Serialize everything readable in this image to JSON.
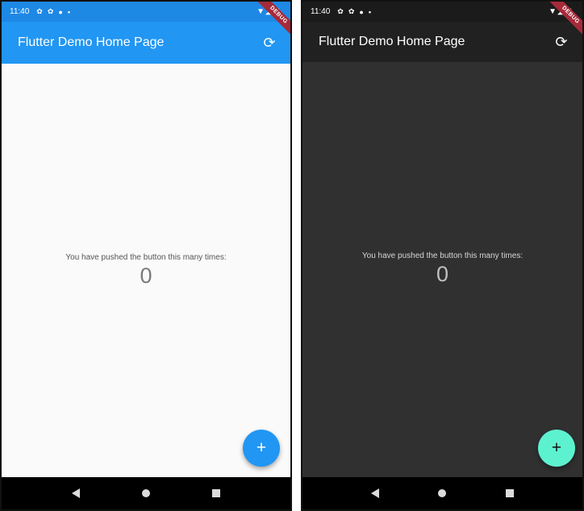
{
  "screens": [
    {
      "theme": "light",
      "status": {
        "time": "11:40",
        "right": "▼◢ ▮"
      },
      "ribbon": "DEBUG",
      "appbar": {
        "title": "Flutter Demo Home Page",
        "action_icon": "refresh-icon",
        "action_glyph": "⟳"
      },
      "counter": {
        "label": "You have pushed the button this many times:",
        "value": "0"
      },
      "fab": {
        "icon": "add-icon",
        "glyph": "+"
      },
      "colors": {
        "primary": "#2196f3",
        "background": "#fafafa",
        "fab": "#2196f3"
      }
    },
    {
      "theme": "dark",
      "status": {
        "time": "11:40",
        "right": "▼◢ ▮"
      },
      "ribbon": "DEBUG",
      "appbar": {
        "title": "Flutter Demo Home Page",
        "action_icon": "refresh-icon",
        "action_glyph": "⟳"
      },
      "counter": {
        "label": "You have pushed the button this many times:",
        "value": "0"
      },
      "fab": {
        "icon": "add-icon",
        "glyph": "+"
      },
      "colors": {
        "primary": "#212121",
        "background": "#303030",
        "fab": "#5df2cf"
      }
    }
  ],
  "navbar": {
    "back_icon": "back-icon",
    "home_icon": "home-icon",
    "recents_icon": "recents-icon"
  }
}
